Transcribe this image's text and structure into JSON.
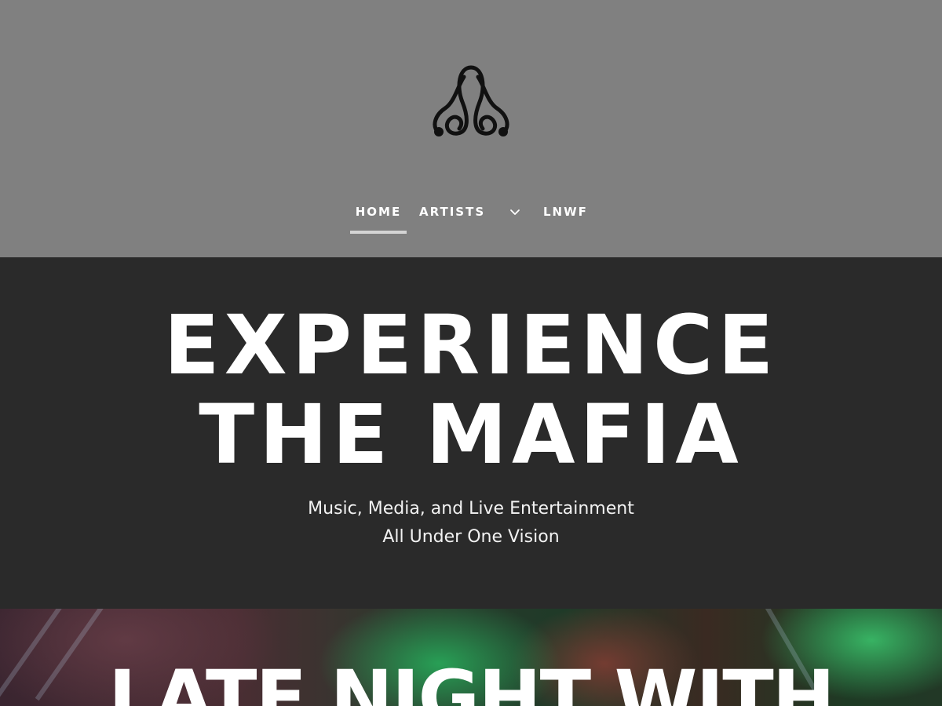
{
  "header": {
    "logo_icon": "treble-clef-monogram-logo",
    "background_color": "#808080"
  },
  "nav": {
    "items": [
      {
        "label": "HOME",
        "active": true
      },
      {
        "label": "ARTISTS",
        "has_dropdown": true
      },
      {
        "label": "LNWF"
      }
    ],
    "chevron_icon": "chevron-down-icon"
  },
  "hero": {
    "title_line1": "EXPERIENCE",
    "title_line2": "THE MAFIA",
    "subtitle_line1": "Music, Media, and Live Entertainment",
    "subtitle_line2": "All Under One Vision",
    "background_color": "#2a2a2a"
  },
  "band": {
    "title": "LATE NIGHT WITH"
  }
}
